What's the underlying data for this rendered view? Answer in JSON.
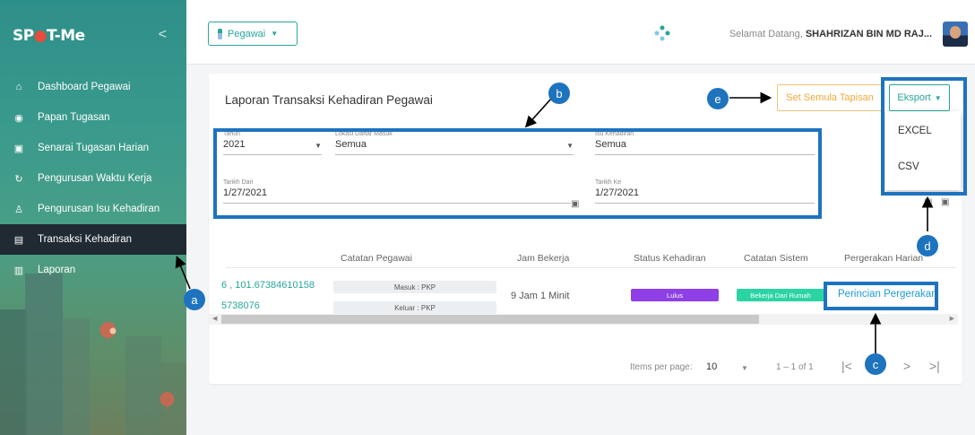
{
  "sidebar": {
    "brand": "SP",
    "brand_pin": "●",
    "brand_rest": "T-Me",
    "collapse_glyph": "<",
    "items": [
      {
        "label": "Dashboard Pegawai",
        "glyph": "⌂"
      },
      {
        "label": "Papan Tugasan",
        "glyph": "◉"
      },
      {
        "label": "Senarai Tugasan Harian",
        "glyph": "▣"
      },
      {
        "label": "Pengurusan Waktu Kerja",
        "glyph": "↻"
      },
      {
        "label": "Pengurusan Isu Kehadiran",
        "glyph": "♙"
      },
      {
        "label": "Transaksi Kehadiran",
        "glyph": "▤"
      },
      {
        "label": "Laporan",
        "glyph": "▥"
      }
    ]
  },
  "topbar": {
    "role_label": "Pegawai",
    "welcome_prefix": "Selamat Datang,",
    "user_name": "SHAHRIZAN BIN MD RAJ..."
  },
  "report": {
    "title": "Laporan Transaksi Kehadiran Pegawai",
    "reset_label": "Set Semula Tapisan",
    "export_label": "Eksport",
    "export_options": [
      "EXCEL",
      "CSV"
    ]
  },
  "filters": {
    "tahun": {
      "label": "Tahun",
      "value": "2021"
    },
    "lokasi": {
      "label": "Lokasi Daftar Masuk",
      "value": "Semua"
    },
    "isu": {
      "label": "Isu Kehadiran",
      "value": "Semua"
    },
    "tarikh_dari": {
      "label": "Tarikh Dari",
      "value": "1/27/2021"
    },
    "tarikh_ke": {
      "label": "Tarikh Ke",
      "value": "1/27/2021"
    }
  },
  "table": {
    "headers": [
      "Catatan Pegawai",
      "Jam Bekerja",
      "Status Kehadiran",
      "Catatan Sistem",
      "Pergerakan Harian"
    ],
    "row": {
      "coord_1": "6 , 101.67384610158",
      "coord_2": "5738076",
      "catatan_masuk": "Masuk : PKP",
      "catatan_keluar": "Keluar : PKP",
      "jam_bekerja": "9 Jam 1 Minit",
      "status": "Lulus",
      "catatan_sistem": "Bekerja Dari Rumah",
      "pergerakan": "Perincian Pergerakan"
    }
  },
  "pagination": {
    "items_per_page_label": "Items per page:",
    "items_per_page_value": "10",
    "range": "1 – 1 of 1",
    "first": "|<",
    "prev": "<",
    "next": ">",
    "last": ">|"
  },
  "annotations": {
    "a": "a",
    "b": "b",
    "c": "c",
    "d": "d",
    "e": "e"
  },
  "colors": {
    "accent": "#26a69a",
    "highlight": "#1e73be",
    "status_lulus": "#8e3fe6",
    "status_sistem": "#2bd4a3",
    "reset": "#f0a93b"
  }
}
